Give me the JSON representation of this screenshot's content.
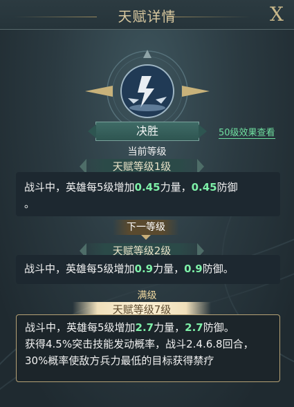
{
  "window": {
    "title": "天赋详情",
    "close_label": "X"
  },
  "talent": {
    "name": "决胜",
    "icon": "lightning-burst-icon"
  },
  "level50_link": "50级效果查看",
  "current": {
    "section_label": "当前等级",
    "level_label": "天赋等级1级",
    "desc": {
      "prefix": "战斗中，英雄每5级增加",
      "v1": "0.45",
      "mid": "力量，",
      "v2": "0.45",
      "suffix": "防御",
      "end": "。"
    }
  },
  "next": {
    "section_label": "下一等级",
    "level_label": "天赋等级2级",
    "desc": {
      "prefix": "战斗中，英雄每5级增加",
      "v1": "0.9",
      "mid": "力量，",
      "v2": "0.9",
      "suffix": "防御。"
    }
  },
  "max": {
    "section_label": "满级",
    "level_label": "天赋等级7级",
    "desc": {
      "prefix": "战斗中，英雄每5级增加",
      "v1": "2.7",
      "mid": "力量，",
      "v2": "2.7",
      "suffix": "防御。",
      "extra": "获得4.5%突击技能发动概率，战斗2.4.6.8回合，30%概率使敌方兵力最低的目标获得禁疗"
    }
  },
  "colors": {
    "highlight": "#7ef0a8",
    "gold_border": "#b7a376",
    "link": "#6fe0a0"
  }
}
